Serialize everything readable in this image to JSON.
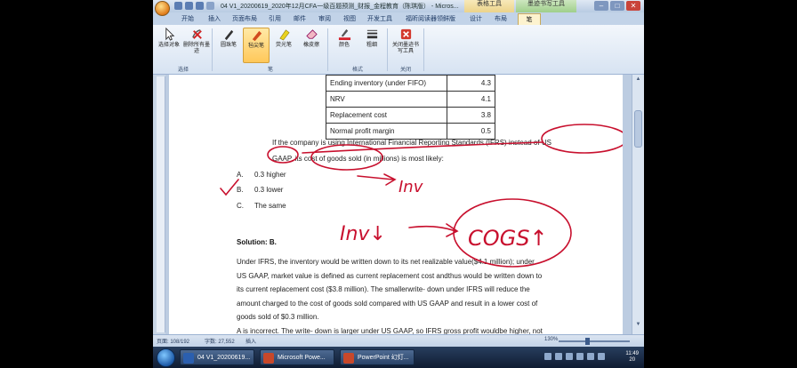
{
  "window": {
    "title": "04 V1_20200619_2020年12月CFA一级百题预测_财报_金程教育（陈琪版） - Micros...",
    "context_tab_a": "表格工具",
    "context_tab_b": "墨迹书写工具"
  },
  "tabs": [
    "开始",
    "插入",
    "页面布局",
    "引用",
    "邮件",
    "审阅",
    "视图",
    "开发工具",
    "福昕阅读器领鲜版",
    "设计",
    "布局",
    "笔"
  ],
  "active_tab_index": 11,
  "ribbon": {
    "buttons": [
      {
        "label": "选择对象",
        "icon": "cursor-icon"
      },
      {
        "label": "删除所有墨迹",
        "icon": "delete-ink-icon"
      },
      {
        "label": "圆珠笔",
        "icon": "ballpoint-pen-icon"
      },
      {
        "label": "毡尖笔",
        "icon": "felt-tip-pen-icon",
        "selected": true
      },
      {
        "label": "荧光笔",
        "icon": "highlighter-icon"
      },
      {
        "label": "橡皮擦",
        "icon": "eraser-icon"
      },
      {
        "label": "颜色",
        "icon": "color-icon",
        "accent": "#d6212b"
      },
      {
        "label": "粗细",
        "icon": "thickness-icon"
      },
      {
        "label": "关闭墨迹书写工具",
        "icon": "close-ink-icon"
      }
    ],
    "groups": [
      "选择",
      "笔",
      "格式",
      "关闭"
    ]
  },
  "document": {
    "table": [
      {
        "label": "Ending inventory (under FIFO)",
        "value": "4.3"
      },
      {
        "label": "NRV",
        "value": "4.1"
      },
      {
        "label": "Replacement cost",
        "value": "3.8"
      },
      {
        "label": "Normal profit margin",
        "value": "0.5"
      }
    ],
    "question_line1": "If the company is using International Financial Reporting Standards (IFRS) instead of US",
    "question_line2": "GAAP, its cost of goods sold (in millions) is most likely:",
    "options": [
      {
        "letter": "A.",
        "text": "0.3 higher"
      },
      {
        "letter": "B.",
        "text": "0.3 lower"
      },
      {
        "letter": "C.",
        "text": "The same"
      }
    ],
    "solution_title": "Solution: B.",
    "solution_lines": [
      "Under IFRS, the inventory would be written down to its net realizable value($4.1 million); under",
      "US GAAP, market value is defined as current replacement cost andthus would be written down to",
      "its current replacement cost ($3.8 million). The smallerwrite- down under IFRS will reduce the",
      "amount charged to the cost of goods sold compared with US GAAP and result in a lower cost of",
      "goods sold of $0.3 million.",
      "A is incorrect. The write- down is larger under US GAAP, so IFRS gross profit wouldbe higher, not"
    ],
    "ink_annotations": [
      "Inv",
      "Inv↓",
      "COGS↑"
    ],
    "ink_color": "#c8102e"
  },
  "status": {
    "page": "页面: 108/192",
    "words": "字数: 27,552",
    "mode": "插入",
    "zoom": "130%"
  },
  "taskbar": {
    "items": [
      {
        "label": "04 V1_20200619...",
        "color": "#2b5faf"
      },
      {
        "label": "Microsoft Powe...",
        "color": "#c8482a"
      },
      {
        "label": "PowerPoint 幻灯...",
        "color": "#c8482a"
      }
    ],
    "clock_time": "11:49",
    "clock_date": "20"
  }
}
